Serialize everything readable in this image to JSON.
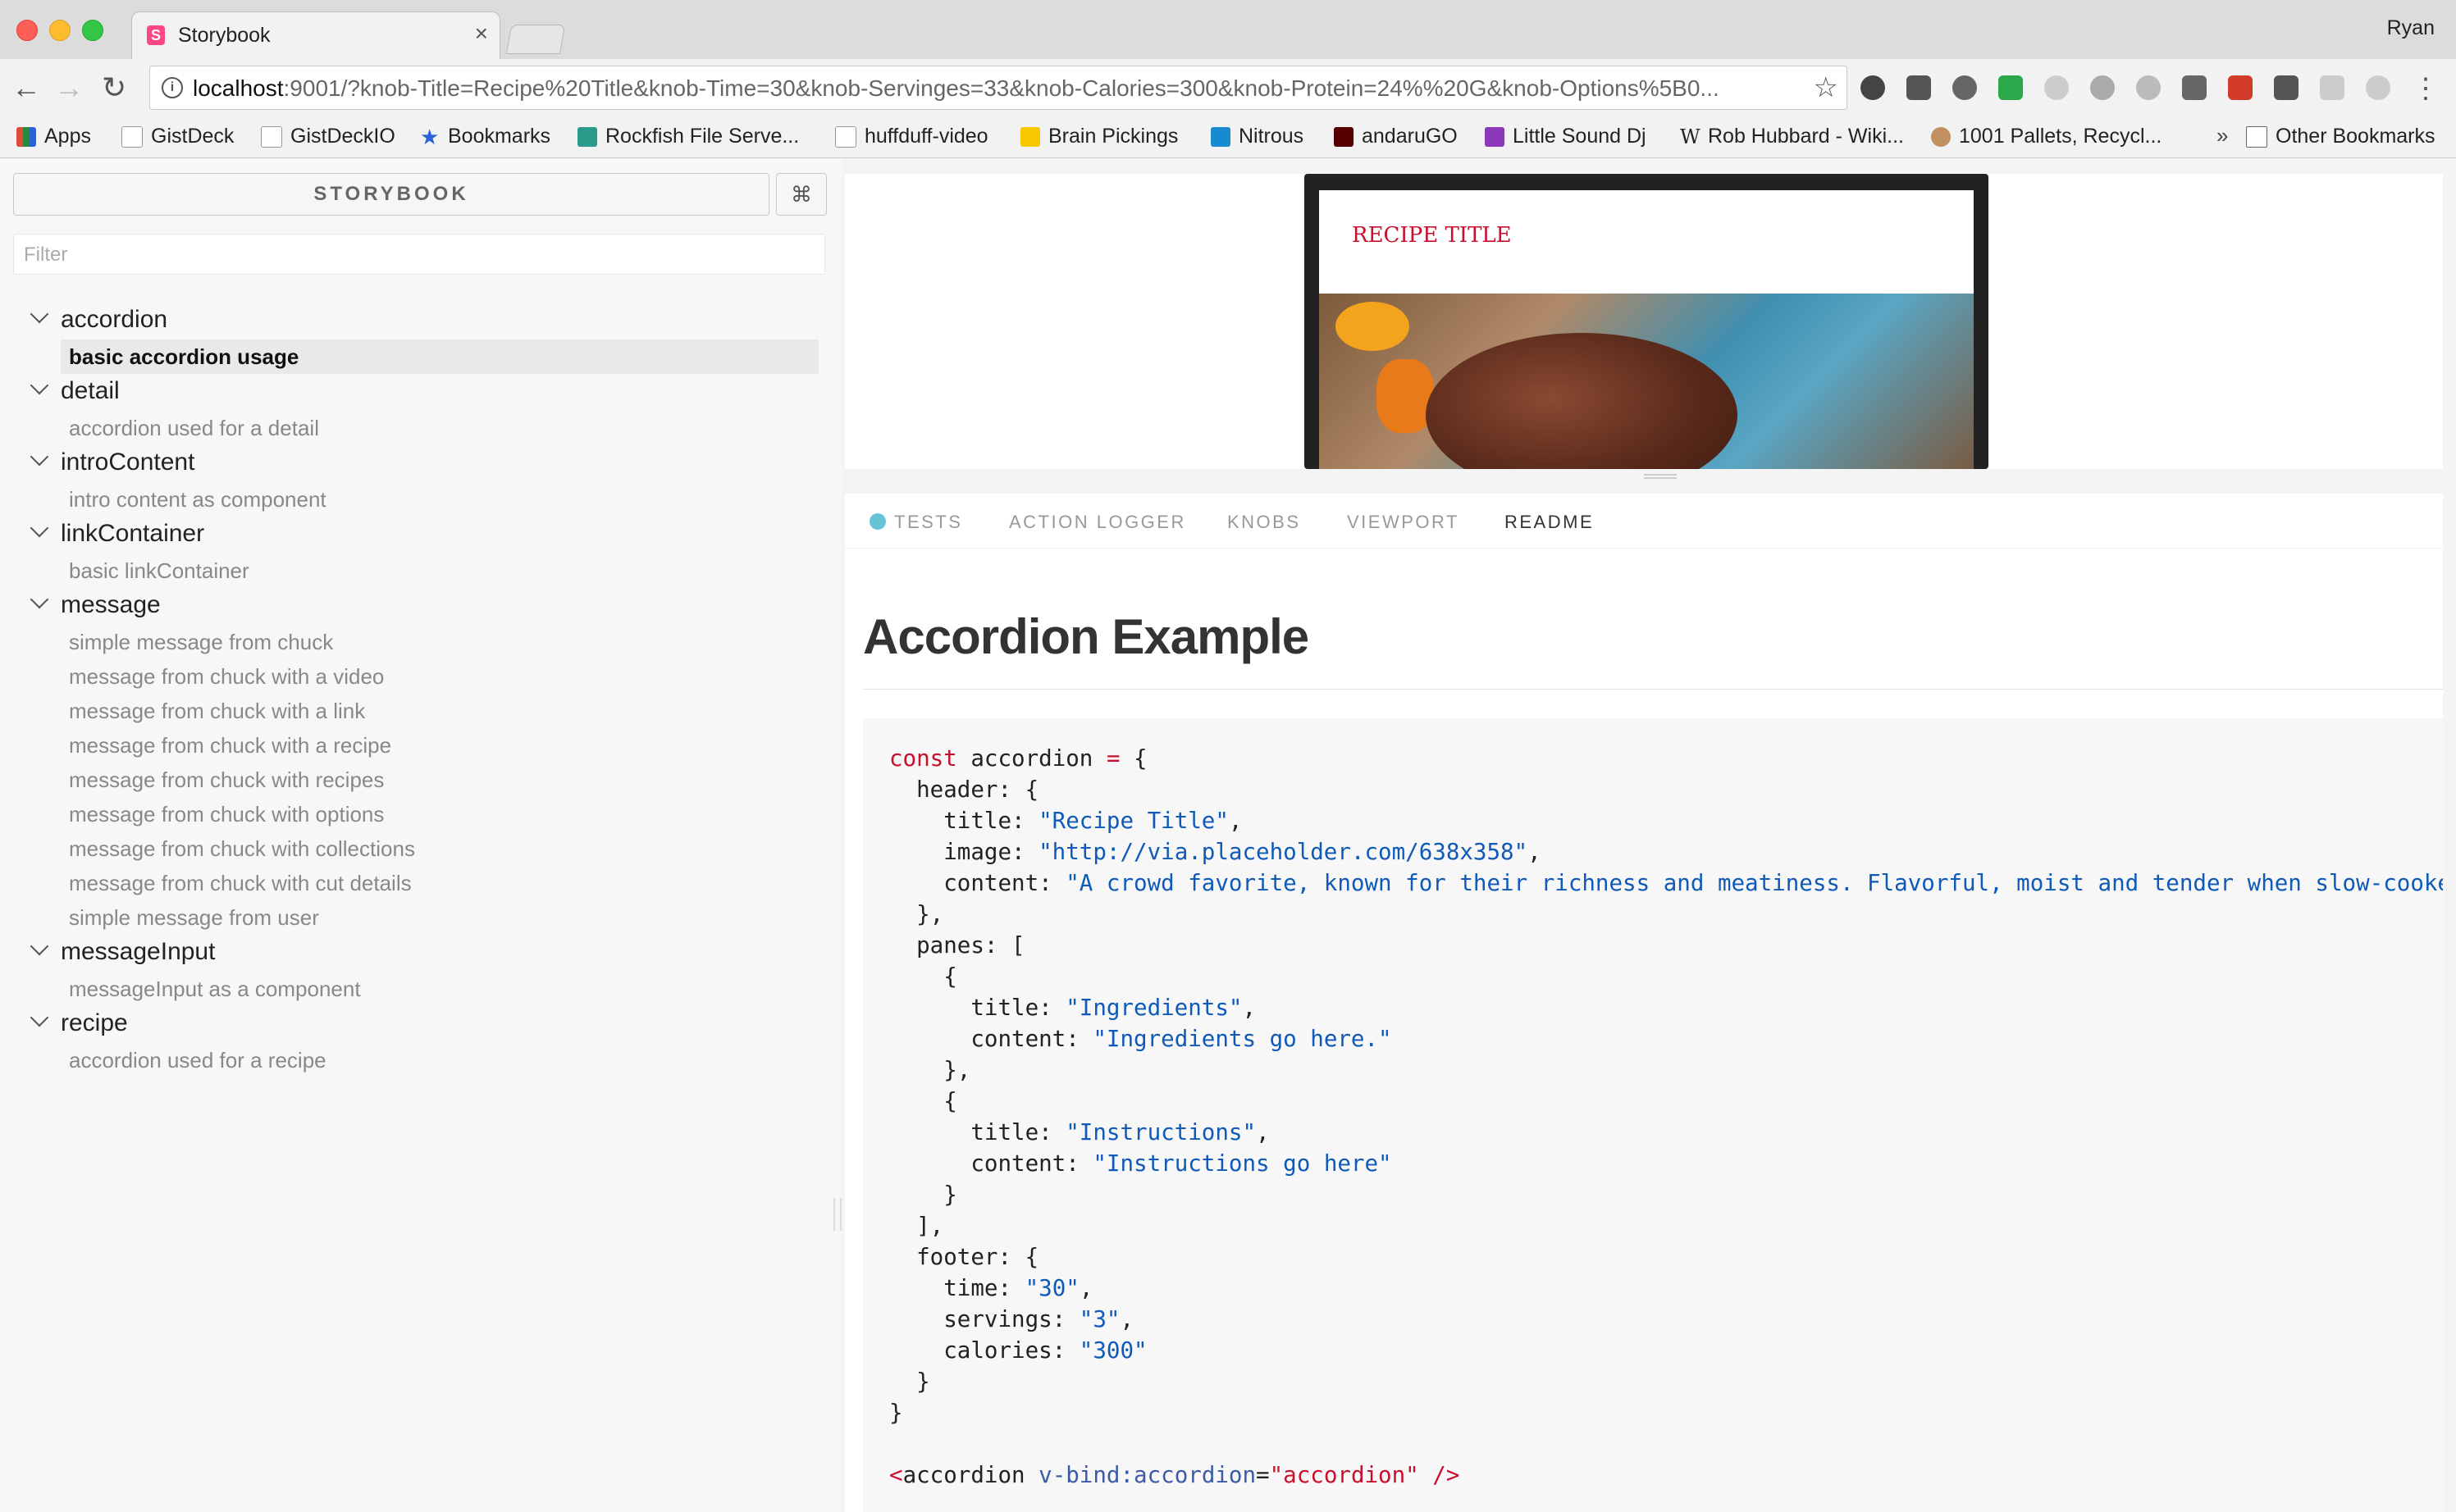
{
  "browser": {
    "tab_title": "Storybook",
    "tab_close": "×",
    "user": "Ryan",
    "url_host": "localhost",
    "url_rest": ":9001/?knob-Title=Recipe%20Title&knob-Time=30&knob-Servinges=33&knob-Calories=300&knob-Protein=24%%20G&knob-Options%5B0...",
    "bookmarks": [
      {
        "label": "Apps",
        "icon": "apps-grid-icon",
        "color": "#e04a3a"
      },
      {
        "label": "GistDeck",
        "icon": "page-icon",
        "color": "#cccccc"
      },
      {
        "label": "GistDeckIO",
        "icon": "page-icon",
        "color": "#cccccc"
      },
      {
        "label": "Bookmarks",
        "icon": "star-icon",
        "color": "#2a62d8"
      },
      {
        "label": "Rockfish File Serve...",
        "icon": "rockfish-icon",
        "color": "#2a9a8a"
      },
      {
        "label": "huffduff-video",
        "icon": "page-icon",
        "color": "#cccccc"
      },
      {
        "label": "Brain Pickings",
        "icon": "brain-pickings-icon",
        "color": "#f5c800"
      },
      {
        "label": "Nitrous",
        "icon": "nitrous-icon",
        "color": "#1a8ad0"
      },
      {
        "label": "andaruGO",
        "icon": "andarugo-icon",
        "color": "#550000"
      },
      {
        "label": "Little Sound Dj",
        "icon": "little-sound-dj-icon",
        "color": "#8a3ab8"
      },
      {
        "label": "Rob Hubbard - Wiki...",
        "icon": "wikipedia-icon",
        "color": "#ffffff"
      },
      {
        "label": "1001 Pallets, Recycl...",
        "icon": "pallets-icon",
        "color": "#c09060"
      }
    ],
    "bookmarks_more": "»",
    "other_bookmarks": "Other Bookmarks"
  },
  "sidebar": {
    "title": "STORYBOOK",
    "shortcut": "⌘",
    "filter_placeholder": "Filter",
    "kinds": [
      {
        "name": "accordion",
        "stories": [
          "basic accordion usage"
        ]
      },
      {
        "name": "detail",
        "stories": [
          "accordion used for a detail"
        ]
      },
      {
        "name": "introContent",
        "stories": [
          "intro content as component"
        ]
      },
      {
        "name": "linkContainer",
        "stories": [
          "basic linkContainer"
        ]
      },
      {
        "name": "message",
        "stories": [
          "simple message from chuck",
          "message from chuck with a video",
          "message from chuck with a link",
          "message from chuck with a recipe",
          "message from chuck with recipes",
          "message from chuck with options",
          "message from chuck with collections",
          "message from chuck with cut details",
          "simple message from user"
        ]
      },
      {
        "name": "messageInput",
        "stories": [
          "messageInput as a component"
        ]
      },
      {
        "name": "recipe",
        "stories": [
          "accordion used for a recipe"
        ]
      }
    ],
    "selected_story": "basic accordion usage"
  },
  "preview": {
    "recipe_title": "RECIPE TITLE"
  },
  "addons": {
    "tabs": [
      "TESTS",
      "ACTION LOGGER",
      "KNOBS",
      "VIEWPORT",
      "README"
    ],
    "active_tab": "README"
  },
  "readme": {
    "heading": "Accordion Example",
    "code": {
      "var_name": "accordion",
      "header_title": "\"Recipe Title\"",
      "header_image": "\"http://via.placeholder.com/638x358\"",
      "header_content": "\"A crowd favorite, known for their richness and meatiness. Flavorful, moist and tender when slow-cooked",
      "pane1_title": "\"Ingredients\"",
      "pane1_content": "\"Ingredients go here.\"",
      "pane2_title": "\"Instructions\"",
      "pane2_content": "\"Instructions go here\"",
      "footer_time": "\"30\"",
      "footer_servings": "\"3\"",
      "footer_calories": "\"300\"",
      "template_tag": "accordion",
      "template_attr": "v-bind:accordion",
      "template_value": "\"accordion\""
    }
  }
}
